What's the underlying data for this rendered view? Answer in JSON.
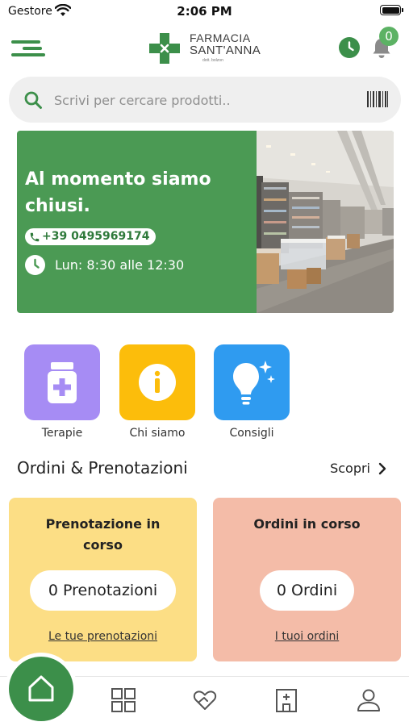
{
  "status_bar": {
    "carrier": "Gestore",
    "time": "2:06 PM"
  },
  "header": {
    "logo": {
      "line1": "FARMACIA",
      "line2": "SANT'ANNA",
      "subtitle": "dott. bolzon"
    },
    "notification_count": "0"
  },
  "search": {
    "placeholder": "Scrivi per cercare prodotti.."
  },
  "banner": {
    "status_text": "Al momento siamo chiusi.",
    "phone": "+39 0495969174",
    "hours": "Lun: 8:30 alle 12:30"
  },
  "quick_actions": [
    {
      "label": "Terapie",
      "color": "#a68cf4",
      "icon": "medicine-jar-icon"
    },
    {
      "label": "Chi siamo",
      "color": "#fcbd0b",
      "icon": "info-icon"
    },
    {
      "label": "Consigli",
      "color": "#2f9bf0",
      "icon": "lightbulb-icon"
    }
  ],
  "orders_section": {
    "title": "Ordini & Prenotazioni",
    "discover": "Scopri",
    "bookings_card": {
      "title": "Prenotazione in corso",
      "count_label": "0 Prenotazioni",
      "link": "Le tue prenotazioni",
      "color": "#fcde85"
    },
    "orders_card": {
      "title": "Ordini in corso",
      "count_label": "0 Ordini",
      "link": "I tuoi ordini",
      "color": "#f4bca8"
    }
  },
  "bottom_nav": {
    "items": [
      "home-icon",
      "grid-icon",
      "heart-hand-icon",
      "pharmacy-building-icon",
      "user-icon"
    ]
  },
  "colors": {
    "brand_green": "#3c8f4a",
    "banner_green": "#4b9a54"
  }
}
